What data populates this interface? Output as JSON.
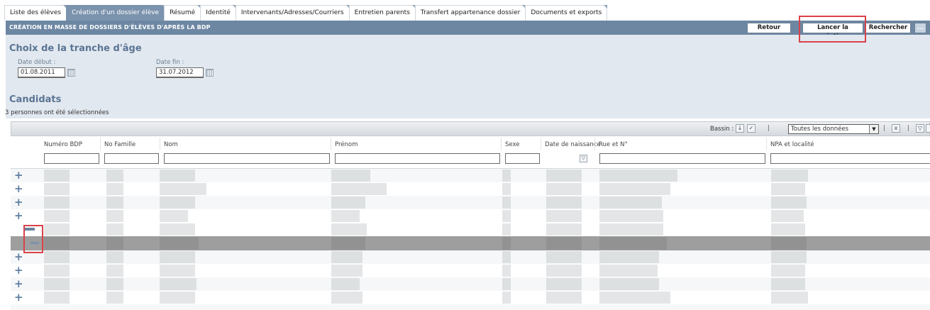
{
  "tabs": [
    {
      "label": "Liste des élèves"
    },
    {
      "label": "Création d'un dossier élève"
    },
    {
      "label": "Résumé"
    },
    {
      "label": "Identité"
    },
    {
      "label": "Intervenants/Adresses/Courriers"
    },
    {
      "label": "Entretien parents"
    },
    {
      "label": "Transfert appartenance dossier"
    },
    {
      "label": "Documents et exports"
    }
  ],
  "header": {
    "title": "CRÉATION EN MASSE DE DOSSIERS D'ÉLÈVES D'APRÈS LA BDP",
    "retour_label": "Retour",
    "lancer_label": "Lancer la création",
    "rechercher_label": "Rechercher",
    "more_label": "..."
  },
  "age_range": {
    "title": "Choix de la tranche d'âge",
    "start_label": "Date début :",
    "start_value": "01.08.2011",
    "end_label": "Date fin :",
    "end_value": "31.07.2012"
  },
  "candidates": {
    "title": "Candidats",
    "selection_text": "3 personnes ont été sélectionnées"
  },
  "toolbar": {
    "bassin_label": "Bassin :",
    "separator": "|",
    "filter_value": "Toutes les données"
  },
  "columns": [
    {
      "label": "Numéro BDP"
    },
    {
      "label": "No Famille"
    },
    {
      "label": "Nom"
    },
    {
      "label": "Prénom"
    },
    {
      "label": "Sexe"
    },
    {
      "label": "Date de naissance"
    },
    {
      "label": "Rue et N°"
    },
    {
      "label": "NPA et localité"
    }
  ],
  "icons": {
    "expand": "+",
    "accent_color": "#6d87a3",
    "highlight_color": "#d9424a"
  }
}
